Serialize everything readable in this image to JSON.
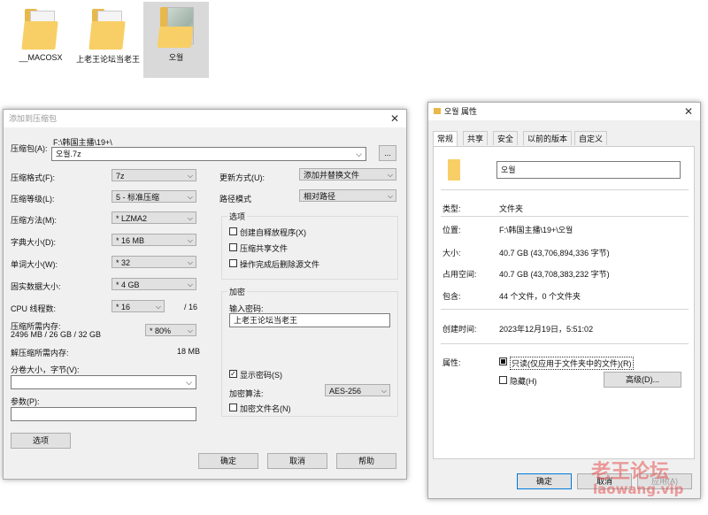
{
  "desktop": {
    "items": [
      {
        "label": "__MACOSX"
      },
      {
        "label": "上老王论坛当老王"
      },
      {
        "label": "오월"
      }
    ]
  },
  "archive_dialog": {
    "title": "添加到压缩包",
    "archive_label": "压缩包(A):",
    "archive_path": "F:\\韩国主播\\19+\\",
    "archive_name": "오월.7z",
    "browse_label": "...",
    "format_label": "压缩格式(F):",
    "format_value": "7z",
    "level_label": "压缩等级(L):",
    "level_value": "5 - 标准压缩",
    "method_label": "压缩方法(M):",
    "method_value": "* LZMA2",
    "dict_label": "字典大小(D):",
    "dict_value": "* 16 MB",
    "word_label": "单词大小(W):",
    "word_value": "* 32",
    "solid_label": "固实数据大小:",
    "solid_value": "* 4 GB",
    "cpu_label": "CPU 线程数:",
    "cpu_value": "* 16",
    "cpu_total": "/ 16",
    "mem_label": "压缩所需内存:",
    "mem_detail": "2496 MB / 26 GB / 32 GB",
    "mem_value": "* 80%",
    "decomp_label": "解压缩所需内存:",
    "decomp_value": "18 MB",
    "split_label": "分卷大小，字节(V):",
    "params_label": "参数(P):",
    "options_button": "选项",
    "update_label": "更新方式(U):",
    "update_value": "添加并替换文件",
    "path_label": "路径模式",
    "path_value": "相对路径",
    "options_group": "选项",
    "opt_sfx": "创建自释放程序(X)",
    "opt_shared": "压缩共享文件",
    "opt_delete": "操作完成后删除源文件",
    "encrypt_group": "加密",
    "password_label": "输入密码:",
    "password_value": "上老王论坛当老王",
    "show_password": "显示密码(S)",
    "enc_method_label": "加密算法:",
    "enc_method_value": "AES-256",
    "enc_names": "加密文件名(N)",
    "ok": "确定",
    "cancel": "取消",
    "help": "帮助"
  },
  "props_dialog": {
    "title": "오월 属性",
    "tabs": [
      "常规",
      "共享",
      "安全",
      "以前的版本",
      "自定义"
    ],
    "name_value": "오월",
    "type_label": "类型:",
    "type_value": "文件夹",
    "location_label": "位置:",
    "location_value": "F:\\韩国主播\\19+\\오월",
    "size_label": "大小:",
    "size_value": "40.7 GB (43,706,894,336 字节)",
    "disk_label": "占用空间:",
    "disk_value": "40.7 GB (43,708,383,232 字节)",
    "contains_label": "包含:",
    "contains_value": "44 个文件，0 个文件夹",
    "created_label": "创建时间:",
    "created_value": "2023年12月19日，5:51:02",
    "attr_label": "属性:",
    "readonly_label": "只读(仅应用于文件夹中的文件)(R)",
    "hidden_label": "隐藏(H)",
    "advanced_button": "高级(D)...",
    "ok": "确定",
    "cancel": "取消",
    "apply": "应用(A)"
  },
  "watermark": {
    "line1": "老王论坛",
    "line2": "laowang.vip"
  }
}
